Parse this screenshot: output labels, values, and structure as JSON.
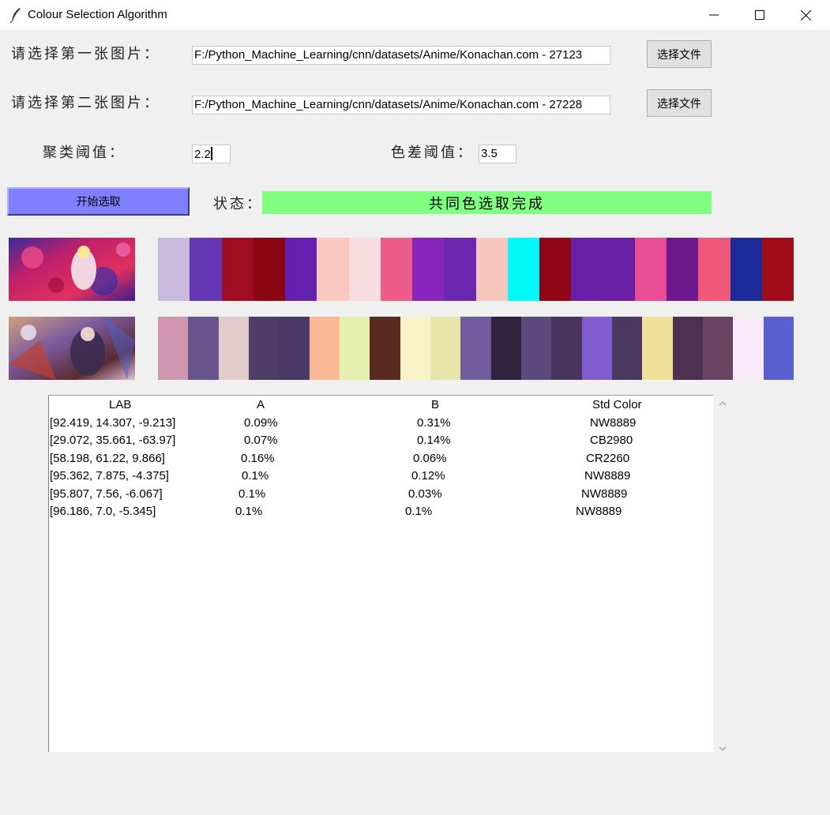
{
  "window": {
    "title": "Colour Selection Algorithm"
  },
  "form": {
    "first_image_label": "请选择第一张图片：",
    "first_image_path": "F:/Python_Machine_Learning/cnn/datasets/Anime/Konachan.com - 27123",
    "second_image_label": "请选择第二张图片：",
    "second_image_path": "F:/Python_Machine_Learning/cnn/datasets/Anime/Konachan.com - 27228",
    "choose_file_label": "选择文件",
    "cluster_threshold_label": "聚类阈值：",
    "cluster_threshold_value": "2.2",
    "color_diff_threshold_label": "色差阈值：",
    "color_diff_threshold_value": "3.5",
    "start_button_label": "开始选取",
    "status_label": "状态：",
    "status_value": "共同色选取完成",
    "status_color": "#80ff80",
    "start_button_color": "#8080ff"
  },
  "palette1": [
    "#c8b9dd",
    "#6436b4",
    "#a00c22",
    "#8a0712",
    "#6320b0",
    "#fac8be",
    "#f8dcdf",
    "#ee5c8c",
    "#8624bb",
    "#6a28b0",
    "#f6c8bd",
    "#00fafa",
    "#900718",
    "#6a1fa6",
    "#6a1ea4",
    "#e84c92",
    "#6e1a8e",
    "#f0587a",
    "#1c2a9a",
    "#a00d18"
  ],
  "palette2": [
    "#d096b0",
    "#6a548e",
    "#e2cccb",
    "#4e3d66",
    "#4a3866",
    "#fab896",
    "#e8f0b0",
    "#5a2a20",
    "#f8f2c6",
    "#e8e4aa",
    "#705c9c",
    "#30233e",
    "#5c4a7e",
    "#4a355e",
    "#805cd0",
    "#4a3860",
    "#f0e09a",
    "#4e3050",
    "#684462",
    "#f8e8f8",
    "#5860d0"
  ],
  "table": {
    "headers": [
      "LAB",
      "A",
      "B",
      "Std Color"
    ],
    "rows": [
      [
        "[92.419, 14.307, -9.213]",
        "0.09%",
        "0.31%",
        "NW8889"
      ],
      [
        "[29.072, 35.661, -63.97]",
        "0.07%",
        "0.14%",
        "CB2980"
      ],
      [
        "[58.198, 61.22, 9.866]",
        "0.16%",
        "0.06%",
        "CR2260"
      ],
      [
        "[95.362, 7.875, -4.375]",
        "0.1%",
        "0.12%",
        "NW8889"
      ],
      [
        "[95.807, 7.56, -6.067]",
        "0.1%",
        "0.03%",
        "NW8889"
      ],
      [
        "[96.186, 7.0, -5.345]",
        "0.1%",
        "0.1%",
        "NW8889"
      ]
    ]
  }
}
